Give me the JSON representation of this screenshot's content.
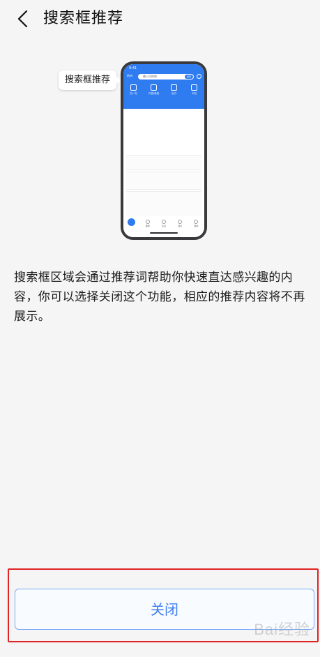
{
  "header": {
    "title": "搜索框推荐",
    "back_icon": "chevron-left-icon"
  },
  "illustration": {
    "callout_text": "搜索框推荐",
    "phone": {
      "status_time": "9:41",
      "city": "杭州",
      "search_placeholder": "输入目的地",
      "search_button": "搜索",
      "tools": [
        {
          "label": "扫一扫",
          "icon": "scan-icon"
        },
        {
          "label": "付钱/收钱",
          "icon": "pay-icon"
        },
        {
          "label": "出行",
          "icon": "travel-icon"
        },
        {
          "label": "卡包",
          "icon": "card-icon"
        }
      ],
      "tabs": [
        {
          "label": "首页",
          "icon": "home-icon"
        },
        {
          "label": "理财",
          "icon": "wealth-icon"
        },
        {
          "label": "生活",
          "icon": "life-icon"
        },
        {
          "label": "消息",
          "icon": "message-icon"
        },
        {
          "label": "我的",
          "icon": "profile-icon"
        }
      ]
    }
  },
  "description": "搜索框区域会通过推荐词帮助你快速直达感兴趣的内容，你可以选择关闭这个功能，相应的推荐内容将不再展示。",
  "close_button": {
    "label": "关闭"
  },
  "watermark": "Bai经验",
  "colors": {
    "accent": "#2f7bf0",
    "button_text": "#3f7ff0",
    "highlight": "#e02323",
    "background": "#f5f5f6"
  }
}
